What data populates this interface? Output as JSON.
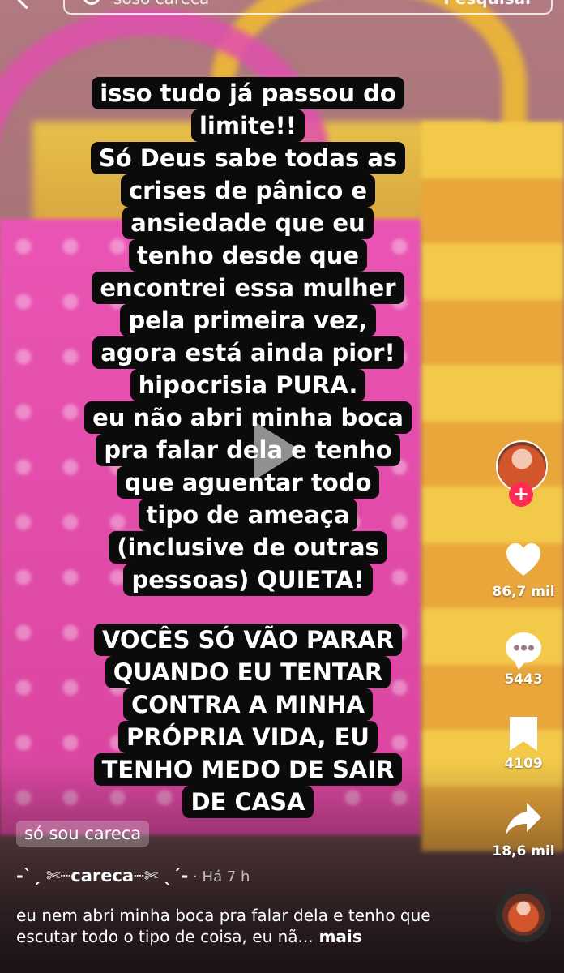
{
  "search": {
    "query": "soso careca",
    "button_label": "Pesquisar"
  },
  "caption": {
    "block1": [
      "isso tudo já passou do",
      "limite!!",
      "Só Deus sabe todas as",
      "crises de pânico e",
      "ansiedade que eu",
      "tenho desde que",
      "encontrei essa mulher",
      "pela primeira vez,",
      "agora está ainda pior!",
      "hipocrisia PURA.",
      "eu não abri minha boca",
      "pra falar dela e tenho",
      "que aguentar todo",
      "tipo de ameaça",
      "(inclusive de outras",
      "pessoas) QUIETA!"
    ],
    "block2": [
      "VOCÊS SÓ VÃO PARAR",
      "QUANDO EU TENTAR",
      "CONTRA A MINHA",
      "PRÓPRIA  VIDA, EU",
      "TENHO MEDO DE SAIR",
      "DE CASA"
    ]
  },
  "actions": {
    "likes": "86,7 mil",
    "comments": "5443",
    "saves": "4109",
    "shares": "18,6 mil",
    "follow_symbol": "+"
  },
  "video": {
    "sound_label": "só sou careca",
    "author": "-ˋˏ ✄┈careca┈✄ ˎˊ-",
    "separator": " · ",
    "time": "Há 7 h",
    "description": "eu nem abri minha boca pra falar dela e tenho que escutar todo o tipo de coisa, eu nã...",
    "more_label": " mais"
  },
  "colors": {
    "follow": "#fe2c55",
    "caption_bg": "#0b0b0b"
  }
}
